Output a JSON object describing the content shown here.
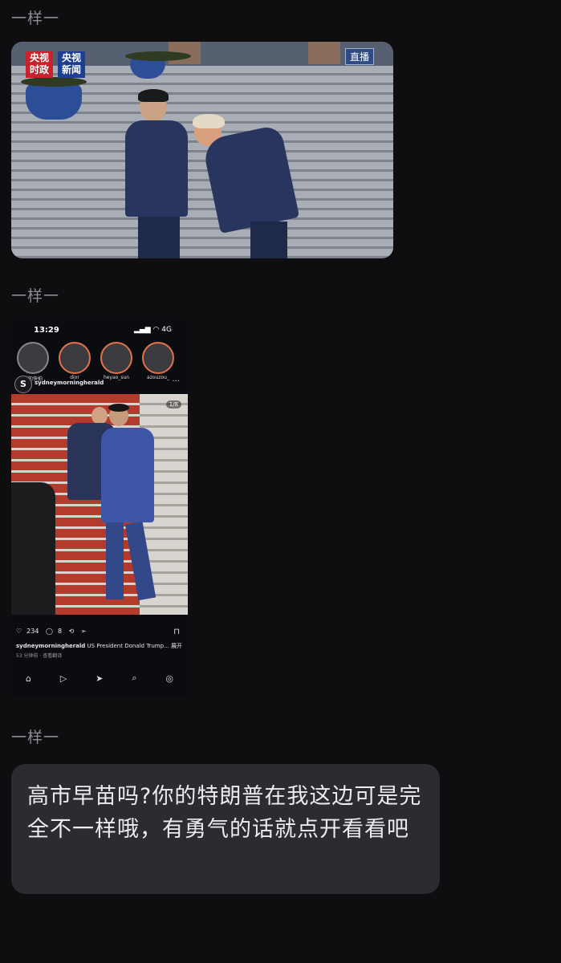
{
  "messages": [
    {
      "sender": "一样一"
    },
    {
      "sender": "一样一"
    },
    {
      "sender": "一样一",
      "text": "高市早苗吗?你的特朗普在我这边可是完全不一样哦，有勇气的话就点开看看吧"
    }
  ],
  "photo1": {
    "logo_left": "央视\n时政",
    "logo_right": "央视\n新闻",
    "live_badge": "直播"
  },
  "phone": {
    "time": "13:29",
    "status": "4G",
    "stories": [
      "你的快拍",
      "dior",
      "heyao_sun",
      "azouzou_"
    ],
    "account": "sydneymorningherald",
    "image_counter": "1/8",
    "likes": "234",
    "comments": "8",
    "caption_account": "sydneymorningherald",
    "caption_text": "US President Donald Trump...",
    "caption_more": "展开",
    "post_time": "53 分钟前 · 查看翻译"
  },
  "colors": {
    "background": "#0e0d10",
    "bubble": "#2c2c30",
    "sender": "#8d8c92"
  }
}
